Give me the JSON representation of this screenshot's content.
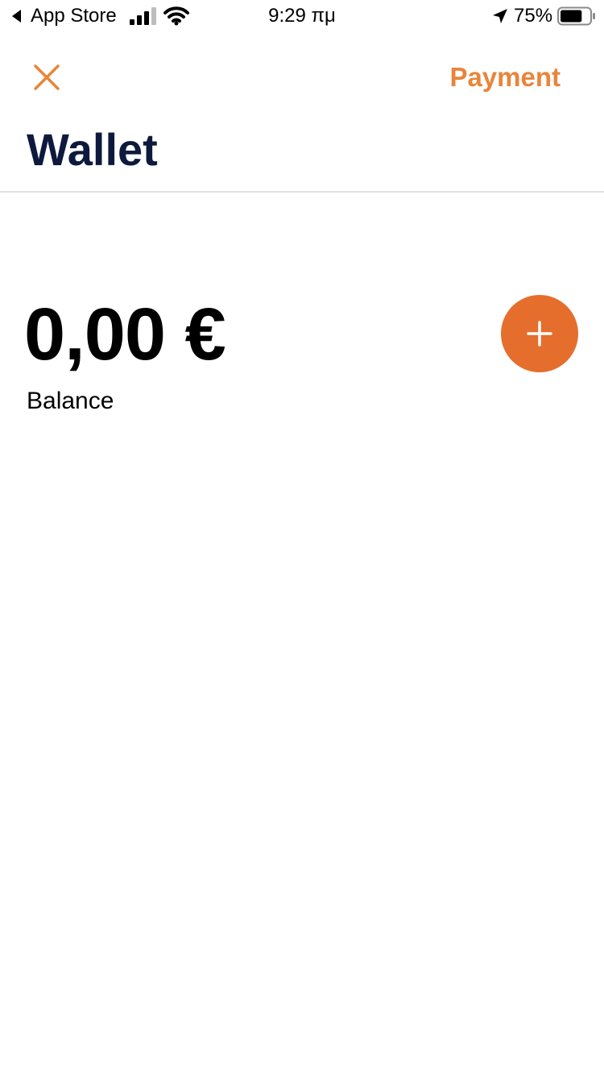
{
  "status_bar": {
    "back_label": "App Store",
    "time": "9:29 πμ",
    "battery_percent": "75%",
    "battery_level": 0.75
  },
  "nav": {
    "close_icon": "close-icon",
    "payment_label": "Payment"
  },
  "page": {
    "title": "Wallet"
  },
  "balance": {
    "amount": "0,00 €",
    "label": "Balance",
    "add_icon": "plus-icon"
  },
  "colors": {
    "accent": "#E8853A",
    "add_button": "#E56E2D",
    "title": "#0E1A3D",
    "divider": "#E2E2E2"
  }
}
